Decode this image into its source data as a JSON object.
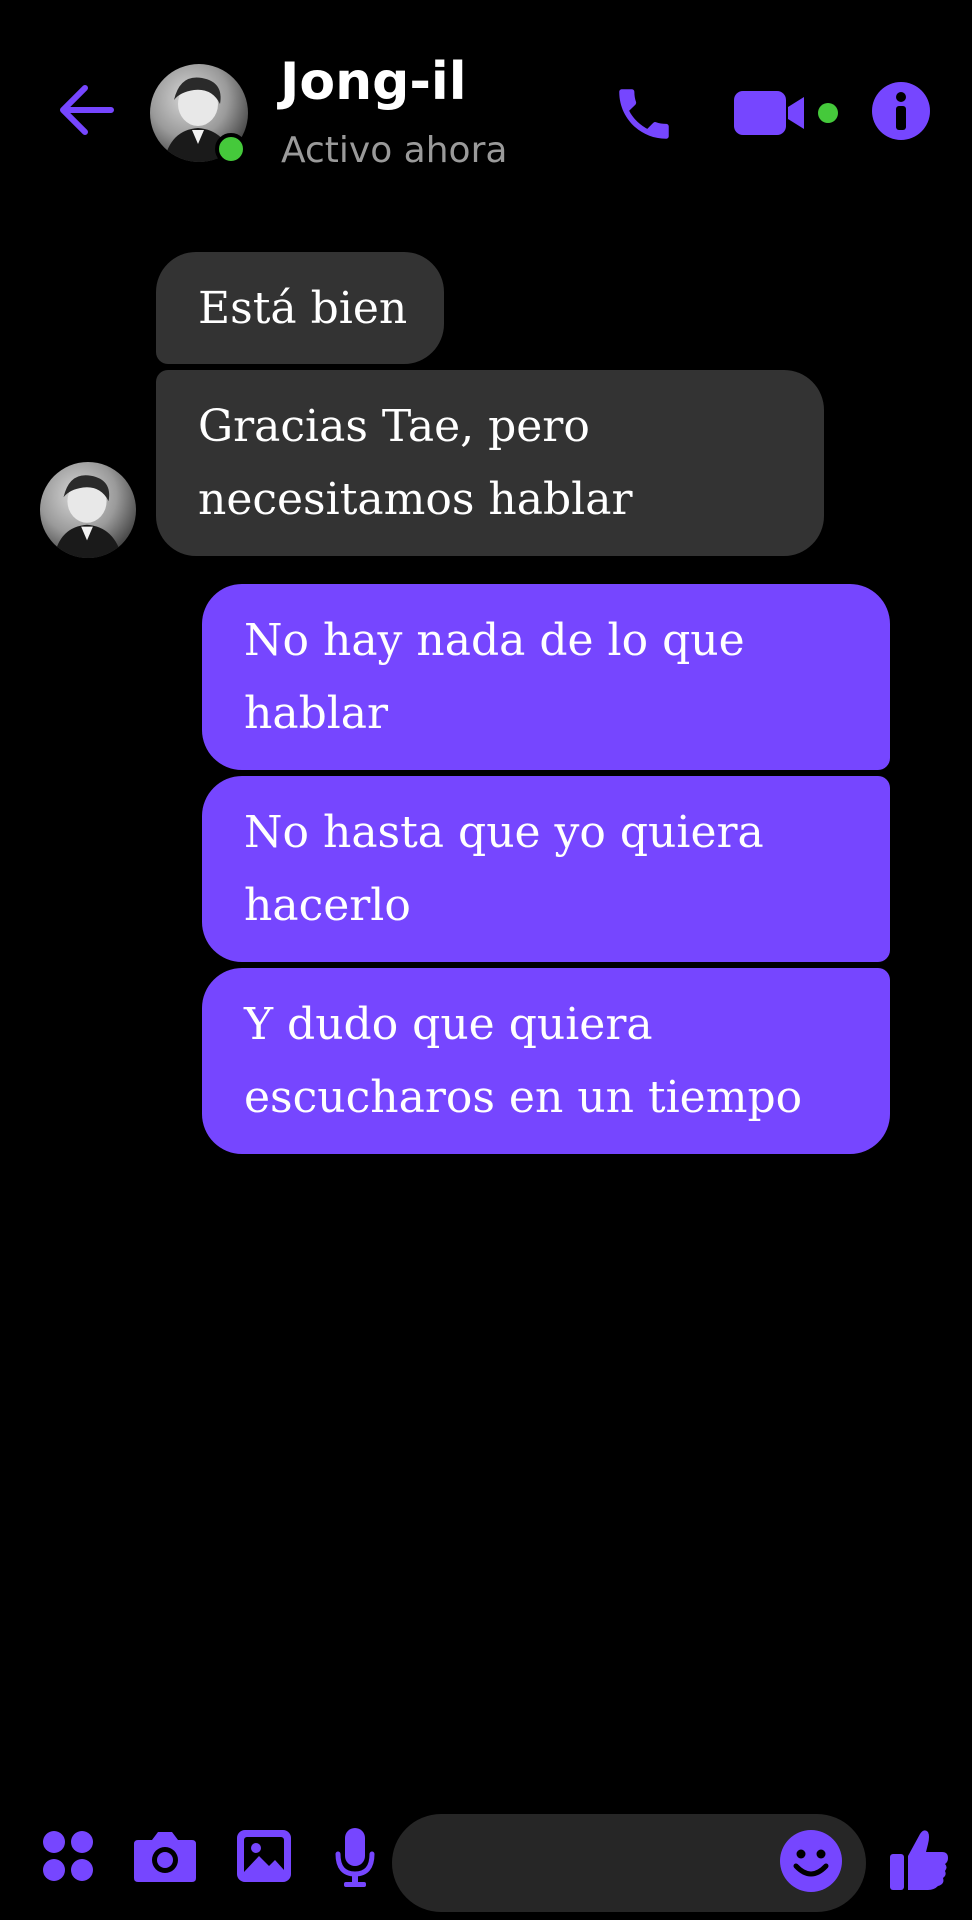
{
  "header": {
    "contact_name": "Jong-il",
    "status": "Activo ahora",
    "presence_color": "#45c93b",
    "icons": [
      "arrow-left-icon",
      "phone-icon",
      "video-camera-icon",
      "info-icon"
    ]
  },
  "theme": {
    "accent": "#7646ff",
    "incoming_bubble": "#333333",
    "background": "#000000"
  },
  "messages": [
    {
      "direction": "incoming",
      "text": "Está bien"
    },
    {
      "direction": "incoming",
      "text": "Gracias Tae, pero necesitamos hablar"
    },
    {
      "direction": "outgoing",
      "text": "No hay nada de lo que hablar"
    },
    {
      "direction": "outgoing",
      "text": "No hasta que yo quiera hacerlo"
    },
    {
      "direction": "outgoing",
      "text": "Y dudo que quiera escucharos en un tiempo"
    }
  ],
  "composer": {
    "placeholder": "",
    "icons": [
      "apps-icon",
      "camera-icon",
      "image-icon",
      "microphone-icon",
      "emoji-icon",
      "thumbs-up-icon"
    ]
  }
}
